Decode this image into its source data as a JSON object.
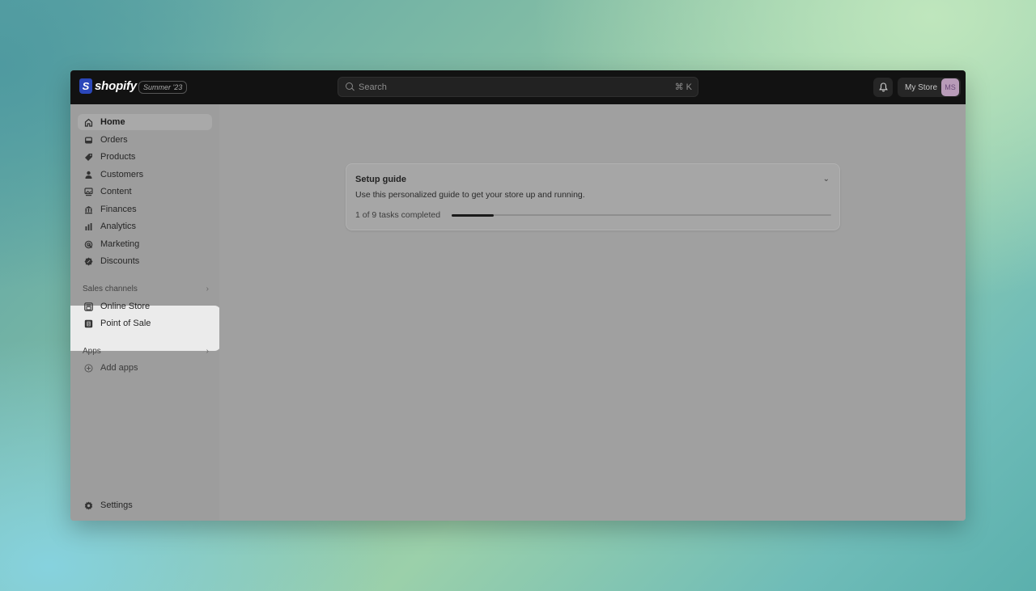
{
  "header": {
    "logo_mark": "S",
    "logo_text": "shopify",
    "edition_badge": "Summer '23",
    "search": {
      "placeholder": "Search",
      "shortcut": "⌘ K"
    },
    "notifications_icon": "bell-icon",
    "store_name": "My Store",
    "avatar_initials": "MS"
  },
  "sidebar": {
    "items": [
      {
        "label": "Home",
        "icon": "home-icon",
        "active": true
      },
      {
        "label": "Orders",
        "icon": "inbox-icon"
      },
      {
        "label": "Products",
        "icon": "tag-icon"
      },
      {
        "label": "Customers",
        "icon": "person-icon"
      },
      {
        "label": "Content",
        "icon": "image-icon"
      },
      {
        "label": "Finances",
        "icon": "bank-icon"
      },
      {
        "label": "Analytics",
        "icon": "bar-chart-icon"
      },
      {
        "label": "Marketing",
        "icon": "target-icon"
      },
      {
        "label": "Discounts",
        "icon": "discount-icon"
      }
    ],
    "sales_channels": {
      "label": "Sales channels",
      "items": [
        {
          "label": "Online Store",
          "icon": "store-icon"
        },
        {
          "label": "Point of Sale",
          "icon": "pos-icon"
        }
      ]
    },
    "apps": {
      "label": "Apps",
      "items": [
        {
          "label": "Add apps",
          "icon": "plus-circle-icon"
        }
      ]
    },
    "settings": {
      "label": "Settings",
      "icon": "gear-icon"
    }
  },
  "setup_guide": {
    "title": "Setup guide",
    "description": "Use this personalized guide to get your store up and running.",
    "progress_text": "1 of 9 tasks completed",
    "completed": 1,
    "total": 9
  },
  "colors": {
    "topbar": "#121212",
    "logo_bag": "#2b47b9",
    "avatar_bg": "#b89bb8",
    "highlight": "#ebebeb"
  }
}
